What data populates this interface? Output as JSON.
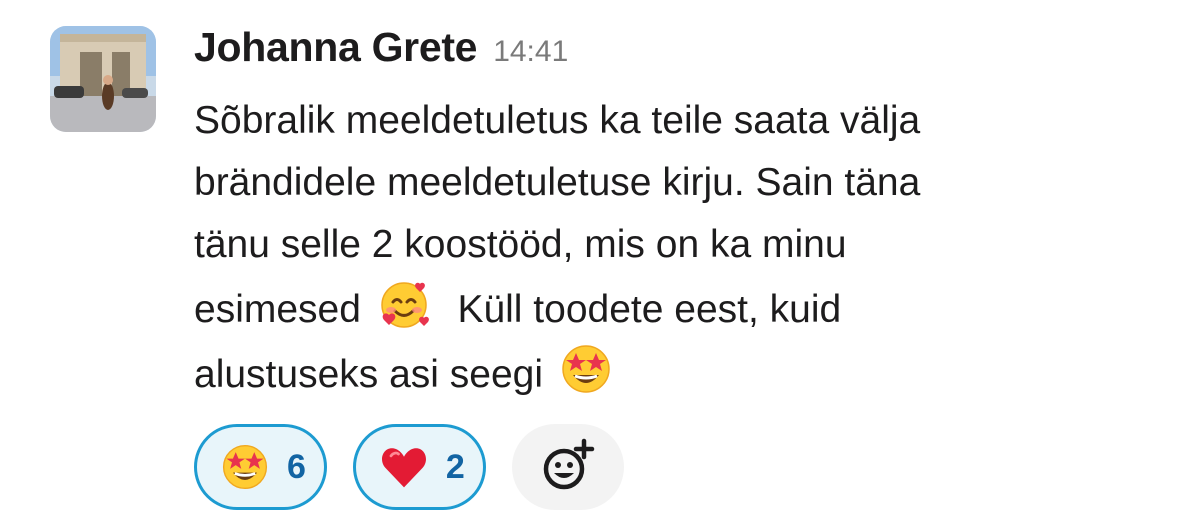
{
  "message": {
    "author": "Johanna Grete",
    "timestamp": "14:41",
    "lines": [
      "Sõbralik meeldetuletus ka teile saata välja",
      "brändidele meeldetuletuse kirju. Sain täna",
      "tänu selle 2 koostööd, mis on ka minu",
      "esimesed",
      "Küll toodete eest, kuid",
      "alustuseks asi seegi"
    ],
    "inline_emojis": [
      "smiling-face-with-hearts",
      "star-struck"
    ]
  },
  "reactions": [
    {
      "emoji": "star-struck",
      "count": "6"
    },
    {
      "emoji": "red-heart",
      "count": "2"
    }
  ],
  "add_reaction": {
    "icon": "add-emoji-icon"
  },
  "colors": {
    "reaction_border": "#1d9bd1",
    "reaction_bg": "#e8f5fa",
    "reaction_count": "#1264a3",
    "timestamp": "#7a7a7a"
  }
}
